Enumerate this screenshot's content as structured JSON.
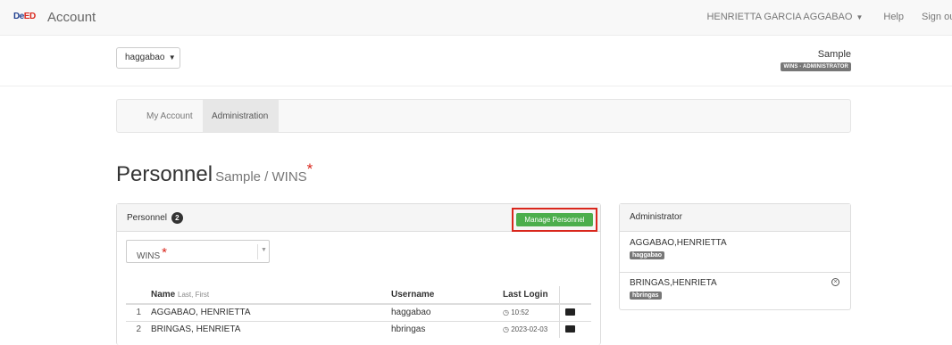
{
  "navbar": {
    "logo_part1": "De",
    "logo_part2": "ED",
    "brand": "Account",
    "user_name": "HENRIETTA GARCIA AGGABAO",
    "help": "Help",
    "signout": "Sign out"
  },
  "account": {
    "dropdown_label": "haggabao",
    "org_name": "Sample",
    "role_badge": "WINS - ADMINISTRATOR"
  },
  "tabs": [
    {
      "label": "My Account",
      "active": false
    },
    {
      "label": "Administration",
      "active": true
    }
  ],
  "heading": {
    "title": "Personnel",
    "subtitle": "Sample / WINS",
    "required_mark": "*"
  },
  "personnel_panel": {
    "title": "Personnel",
    "count": "2",
    "manage_button": "Manage Personnel",
    "select_value": "WINS",
    "select_required_mark": "*",
    "columns": {
      "name": "Name",
      "name_hint": "Last, First",
      "username": "Username",
      "last_login": "Last Login"
    },
    "rows": [
      {
        "index": "1",
        "name": "AGGABAO, HENRIETTA",
        "username": "haggabao",
        "last_login": "10:52"
      },
      {
        "index": "2",
        "name": "BRINGAS, HENRIETA",
        "username": "hbringas",
        "last_login": "2023-02-03"
      }
    ]
  },
  "admin_panel": {
    "title": "Administrator",
    "items": [
      {
        "name": "AGGABAO,HENRIETTA",
        "username": "haggabao"
      },
      {
        "name": "BRINGAS,HENRIETA",
        "username": "hbringas"
      }
    ]
  },
  "icons": {
    "clock": "clock-icon",
    "folder": "folder-icon",
    "remove": "remove-circle-icon"
  },
  "colors": {
    "accent_red": "#d9261c",
    "success_green": "#4cae4c",
    "badge_gray": "#777777"
  }
}
